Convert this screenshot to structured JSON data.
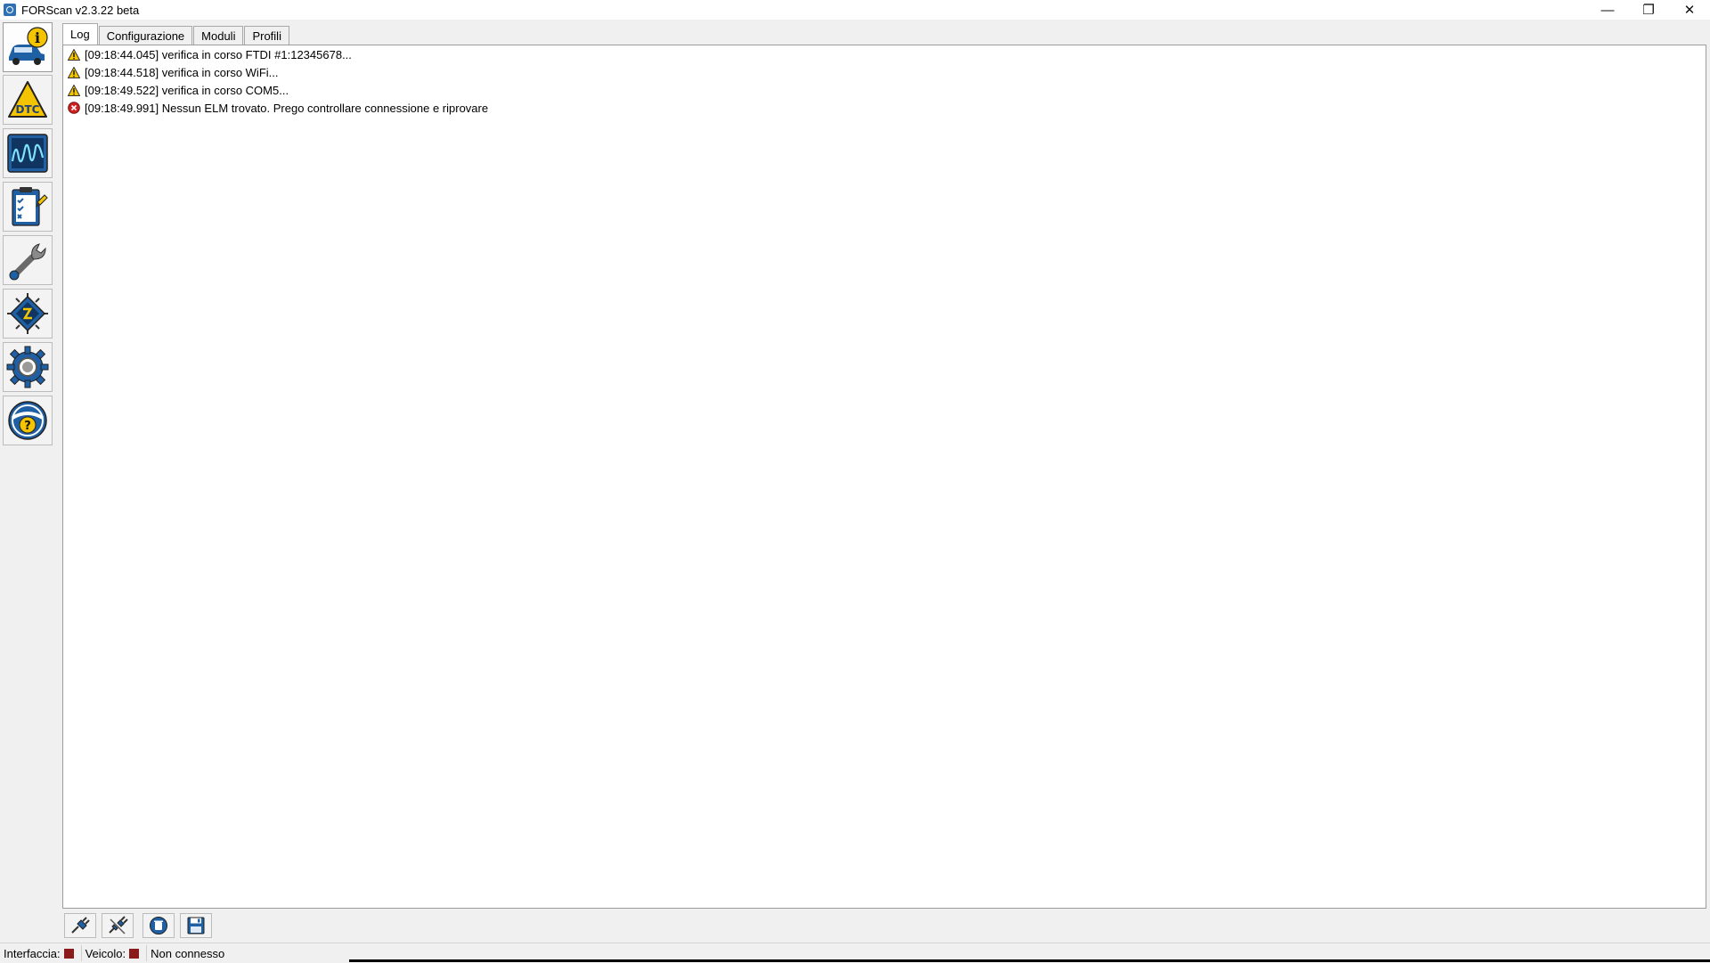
{
  "window": {
    "title": "FORScan v2.3.22 beta",
    "controls": {
      "minimize": "—",
      "restore": "❐",
      "close": "✕"
    }
  },
  "tabs": [
    {
      "label": "Log",
      "active": true
    },
    {
      "label": "Configurazione",
      "active": false
    },
    {
      "label": "Moduli",
      "active": false
    },
    {
      "label": "Profili",
      "active": false
    }
  ],
  "toolbar": {
    "items": [
      {
        "name": "vehicle-info-icon",
        "active": true
      },
      {
        "name": "dtc-icon",
        "label": "DTC"
      },
      {
        "name": "oscilloscope-icon"
      },
      {
        "name": "checklist-icon"
      },
      {
        "name": "wrench-icon"
      },
      {
        "name": "chip-icon"
      },
      {
        "name": "gear-icon"
      },
      {
        "name": "help-icon",
        "label": "?"
      }
    ]
  },
  "log": [
    {
      "type": "warning",
      "text": "[09:18:44.045] verifica in corso FTDI #1:12345678..."
    },
    {
      "type": "warning",
      "text": "[09:18:44.518] verifica in corso WiFi..."
    },
    {
      "type": "warning",
      "text": "[09:18:49.522] verifica in corso COM5..."
    },
    {
      "type": "error",
      "text": "[09:18:49.991] Nessun ELM trovato. Prego controllare connessione e riprovare"
    }
  ],
  "status": {
    "interface_label": "Interfaccia:",
    "vehicle_label": "Veicolo:",
    "connection_text": "Non connesso",
    "led_color": "#8b1a1a"
  },
  "colors": {
    "accent_blue": "#1f5fa3",
    "warning_yellow": "#f5c400",
    "error_red": "#cc2222"
  }
}
